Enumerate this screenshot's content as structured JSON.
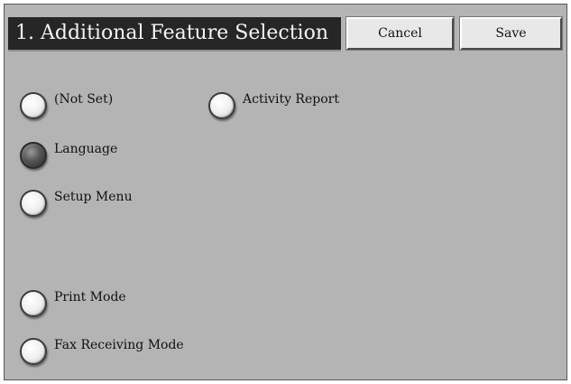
{
  "screen": {
    "title": "1. Additional Feature Selection",
    "buttons": {
      "cancel_label": "Cancel",
      "save_label": "Save"
    },
    "options": {
      "not_set": "(Not Set)",
      "activity_report": "Activity Report",
      "language": "Language",
      "setup_menu": "Setup Menu",
      "print_mode": "Print Mode",
      "fax_receiving_mode": "Fax Receiving Mode"
    },
    "selected_option": "Language"
  }
}
